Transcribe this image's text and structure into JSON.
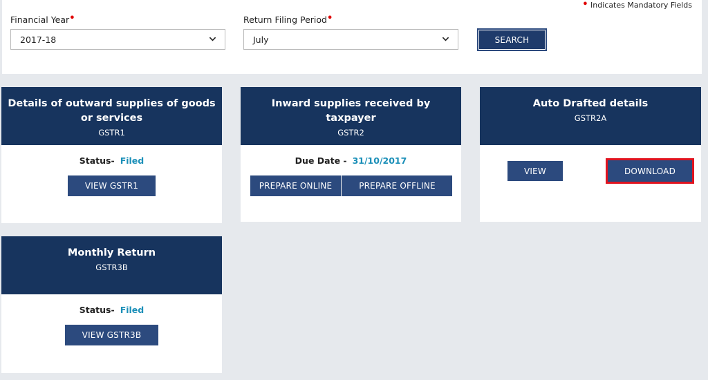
{
  "filters": {
    "mandatory_note": "Indicates Mandatory Fields",
    "financial_year_label": "Financial Year",
    "financial_year_value": "2017-18",
    "return_period_label": "Return Filing Period",
    "return_period_value": "July",
    "search_label": "SEARCH"
  },
  "cards": [
    {
      "title": "Details of outward supplies of goods or services",
      "code": "GSTR1",
      "status_label": "Status-",
      "status_value": "Filed",
      "button": "VIEW GSTR1"
    },
    {
      "title": "Inward supplies received by taxpayer",
      "code": "GSTR2",
      "due_label": "Due Date -",
      "due_value": "31/10/2017",
      "button_online": "PREPARE ONLINE",
      "button_offline": "PREPARE OFFLINE"
    },
    {
      "title": "Auto Drafted details",
      "code": "GSTR2A",
      "button_view": "VIEW",
      "button_download": "DOWNLOAD"
    },
    {
      "title": "Monthly Return",
      "code": "GSTR3B",
      "status_label": "Status-",
      "status_value": "Filed",
      "button": "VIEW GSTR3B"
    }
  ],
  "colors": {
    "header_navy": "#17345e",
    "button_blue": "#2c4a7e",
    "status_teal": "#1b8fb8",
    "highlight_red": "#e0131f"
  }
}
